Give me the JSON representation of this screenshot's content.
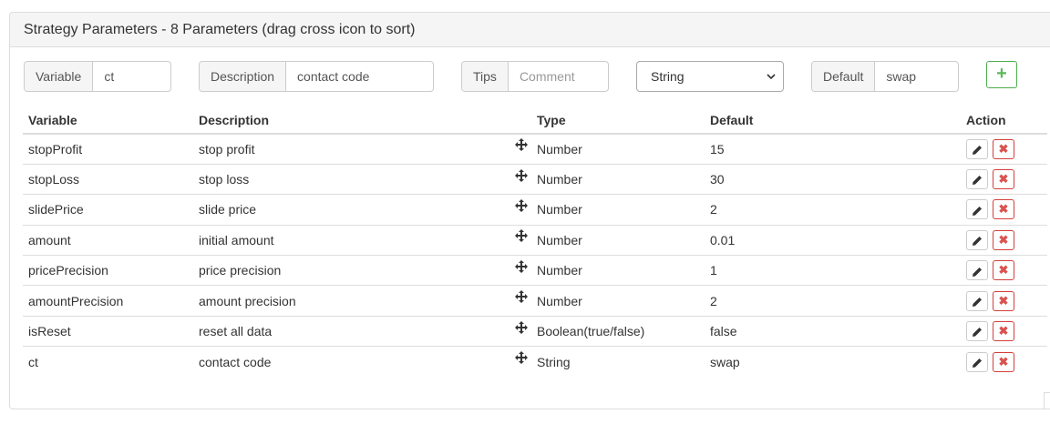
{
  "panel": {
    "title": "Strategy Parameters - 8 Parameters (drag cross icon to sort)"
  },
  "form": {
    "variable_label": "Variable",
    "variable_value": "ct",
    "description_label": "Description",
    "description_value": "contact code",
    "tips_label": "Tips",
    "tips_placeholder": "Comment",
    "type_selected": "String",
    "default_label": "Default",
    "default_value": "swap",
    "add_label": "+"
  },
  "table": {
    "headers": {
      "variable": "Variable",
      "description": "Description",
      "type": "Type",
      "default": "Default",
      "action": "Action"
    },
    "rows": [
      {
        "variable": "stopProfit",
        "description": "stop profit",
        "type": "Number",
        "default": "15"
      },
      {
        "variable": "stopLoss",
        "description": "stop loss",
        "type": "Number",
        "default": "30"
      },
      {
        "variable": "slidePrice",
        "description": "slide price",
        "type": "Number",
        "default": "2"
      },
      {
        "variable": "amount",
        "description": "initial amount",
        "type": "Number",
        "default": "0.01"
      },
      {
        "variable": "pricePrecision",
        "description": "price precision",
        "type": "Number",
        "default": "1"
      },
      {
        "variable": "amountPrecision",
        "description": "amount precision",
        "type": "Number",
        "default": "2"
      },
      {
        "variable": "isReset",
        "description": "reset all data",
        "type": "Boolean(true/false)",
        "default": "false"
      },
      {
        "variable": "ct",
        "description": "contact code",
        "type": "String",
        "default": "swap"
      }
    ],
    "delete_glyph": "✖"
  },
  "icons": {
    "drag": "move-cross-icon",
    "edit": "pencil-icon",
    "delete": "close-icon",
    "add": "plus-icon",
    "dropdown": "chevron-down-icon"
  },
  "colors": {
    "add_green": "#5cb85c",
    "delete_red": "#d9534f",
    "heading_bg": "#f5f5f5"
  }
}
